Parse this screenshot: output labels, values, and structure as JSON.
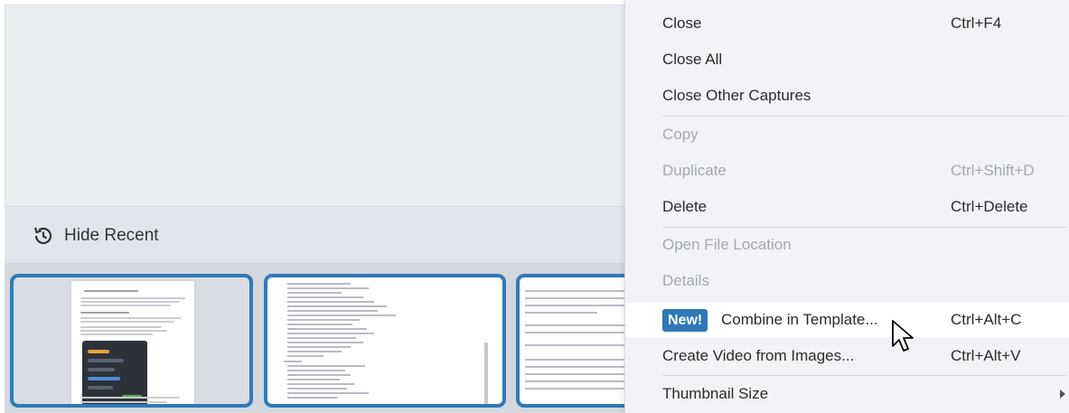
{
  "recent": {
    "hide_label": "Hide Recent"
  },
  "menu": {
    "items": [
      {
        "label": "Close",
        "shortcut": "Ctrl+F4",
        "enabled": true
      },
      {
        "label": "Close All",
        "shortcut": "",
        "enabled": true
      },
      {
        "label": "Close Other Captures",
        "shortcut": "",
        "enabled": true
      },
      {
        "label": "Copy",
        "shortcut": "",
        "enabled": false
      },
      {
        "label": "Duplicate",
        "shortcut": "Ctrl+Shift+D",
        "enabled": false
      },
      {
        "label": "Delete",
        "shortcut": "Ctrl+Delete",
        "enabled": true
      },
      {
        "label": "Open File Location",
        "shortcut": "",
        "enabled": false
      },
      {
        "label": "Details",
        "shortcut": "",
        "enabled": false
      },
      {
        "badge": "New!",
        "label": "Combine in Template...",
        "shortcut": "Ctrl+Alt+C",
        "enabled": true
      },
      {
        "label": "Create Video from Images...",
        "shortcut": "Ctrl+Alt+V",
        "enabled": true
      },
      {
        "label": "Thumbnail Size",
        "shortcut": "",
        "enabled": true,
        "submenu": true
      }
    ]
  },
  "thumbnails": {
    "count": 3,
    "selected_border_color": "#2f79b8"
  },
  "colors": {
    "accent": "#2f79b8",
    "disabled_text": "#a3a8b0",
    "menu_bg": "#f1f3f6"
  }
}
